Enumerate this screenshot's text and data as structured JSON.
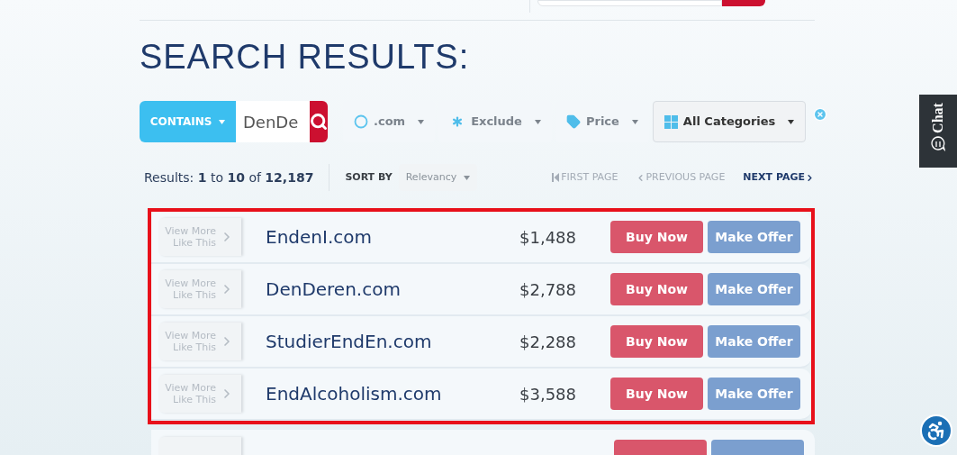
{
  "title": "SEARCH RESULTS:",
  "search": {
    "mode": "CONTAINS",
    "value": "DenDe"
  },
  "filters": [
    {
      "kind": "extension",
      "label": ".com"
    },
    {
      "kind": "exclude",
      "label": "Exclude"
    },
    {
      "kind": "price",
      "label": "Price"
    },
    {
      "kind": "categories",
      "label": "All Categories"
    }
  ],
  "results_summary": {
    "prefix": "Results:",
    "from": "1",
    "to_word": "to",
    "to": "10",
    "of_word": "of",
    "total": "12,187"
  },
  "sort": {
    "label": "SORT BY",
    "value": "Relevancy"
  },
  "pagination": [
    {
      "label": "FIRST PAGE",
      "disabled": true,
      "kind": "first"
    },
    {
      "label": "PREVIOUS PAGE",
      "disabled": true,
      "kind": "prev"
    },
    {
      "label": "NEXT PAGE",
      "disabled": false,
      "kind": "next"
    }
  ],
  "rows": [
    {
      "view_more": [
        "View More",
        "Like This"
      ],
      "domain": "EndenI.com",
      "price": "$1,488",
      "buy": "Buy Now",
      "offer": "Make Offer"
    },
    {
      "view_more": [
        "View More",
        "Like This"
      ],
      "domain": "DenDeren.com",
      "price": "$2,788",
      "buy": "Buy Now",
      "offer": "Make Offer"
    },
    {
      "view_more": [
        "View More",
        "Like This"
      ],
      "domain": "StudierEndEn.com",
      "price": "$2,288",
      "buy": "Buy Now",
      "offer": "Make Offer"
    },
    {
      "view_more": [
        "View More",
        "Like This"
      ],
      "domain": "EndAlcoholism.com",
      "price": "$3,588",
      "buy": "Buy Now",
      "offer": "Make Offer"
    }
  ],
  "chat_tab": {
    "label": "Chat"
  }
}
